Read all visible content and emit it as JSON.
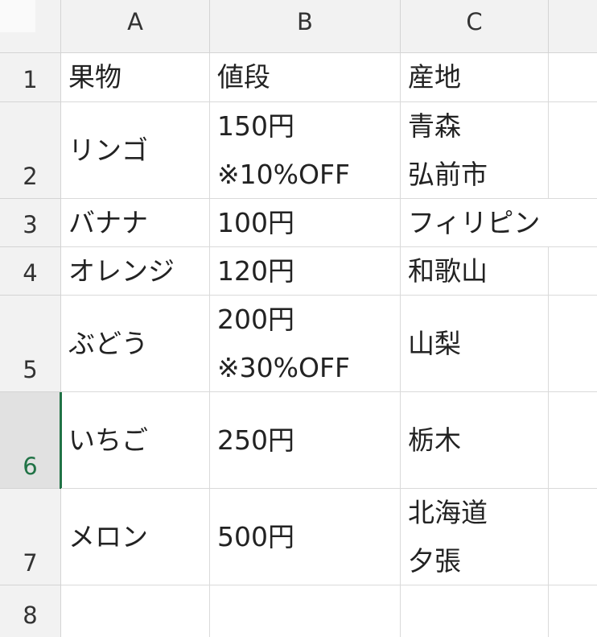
{
  "columns": [
    "A",
    "B",
    "C"
  ],
  "rows": [
    {
      "num": "1",
      "a": "果物",
      "b": [
        "値段"
      ],
      "c": [
        "産地"
      ]
    },
    {
      "num": "2",
      "a": "リンゴ",
      "b": [
        "150円",
        "※10%OFF"
      ],
      "c": [
        "青森",
        "弘前市"
      ]
    },
    {
      "num": "3",
      "a": "バナナ",
      "b": [
        "100円"
      ],
      "c": [
        "フィリピン"
      ]
    },
    {
      "num": "4",
      "a": "オレンジ",
      "b": [
        "120円"
      ],
      "c": [
        "和歌山"
      ]
    },
    {
      "num": "5",
      "a": "ぶどう",
      "b": [
        "200円",
        "※30%OFF"
      ],
      "c": [
        "山梨"
      ]
    },
    {
      "num": "6",
      "a": "いちご",
      "b": [
        "250円"
      ],
      "c": [
        "栃木"
      ]
    },
    {
      "num": "7",
      "a": "メロン",
      "b": [
        "500円"
      ],
      "c": [
        "北海道",
        "夕張"
      ]
    },
    {
      "num": "8",
      "a": "",
      "b": [
        ""
      ],
      "c": [
        ""
      ]
    }
  ],
  "selected_row": "6",
  "colors": {
    "accent": "#217346",
    "header_bg": "#f2f2f2",
    "grid": "#dadada"
  }
}
